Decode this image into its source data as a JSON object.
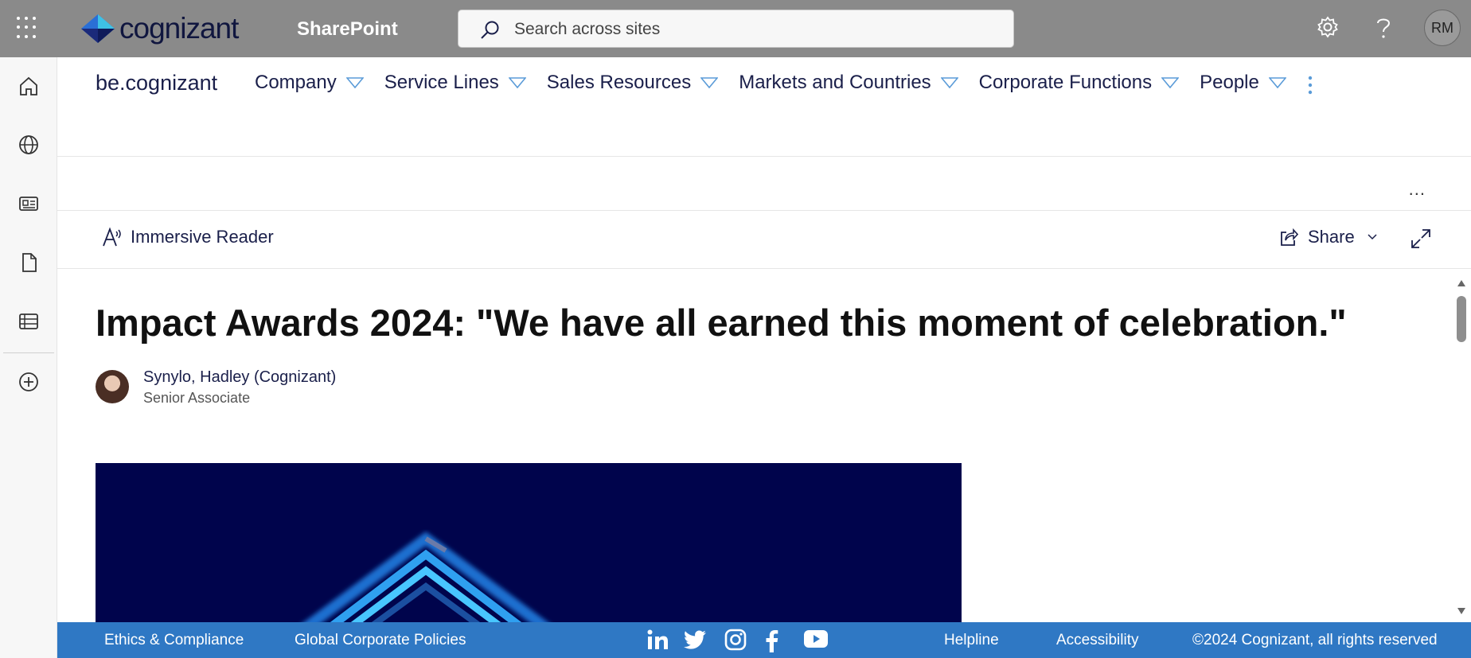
{
  "suite_bar": {
    "logo_text": "cognizant",
    "app_name": "SharePoint",
    "search_placeholder": "Search across sites",
    "user_initials": "RM",
    "icons": [
      "app-launcher-icon",
      "settings-icon",
      "help-icon"
    ]
  },
  "left_rail": {
    "items": [
      "home-icon",
      "globe-icon",
      "news-icon",
      "file-icon",
      "list-icon",
      "add-icon"
    ]
  },
  "hub_nav": {
    "site_name": "be.cognizant",
    "items": [
      {
        "label": "Company"
      },
      {
        "label": "Service Lines"
      },
      {
        "label": "Sales Resources"
      },
      {
        "label": "Markets and Countries"
      },
      {
        "label": "Corporate Functions"
      },
      {
        "label": "People"
      }
    ]
  },
  "command_bar": {
    "more_label": "...",
    "immersive_reader": "Immersive Reader",
    "share": "Share"
  },
  "article": {
    "title": "Impact Awards 2024: \"We have all earned this moment of celebration.\"",
    "author_name": "Synylo, Hadley (Cognizant)",
    "author_role": "Senior Associate"
  },
  "footer": {
    "links": [
      "Ethics & Compliance",
      "Global Corporate Policies",
      "Helpline",
      "Accessibility"
    ],
    "copyright": "©2024 Cognizant, all rights reserved",
    "social": [
      "linkedin-icon",
      "twitter-icon",
      "instagram-icon",
      "facebook-icon",
      "youtube-icon"
    ]
  },
  "colors": {
    "suite_bar": "#8a8a8a",
    "footer": "#2f78c4",
    "nav_text": "#1a1f4a",
    "hero_bg": "#00044c",
    "accent_caret": "#5a9bd8"
  }
}
